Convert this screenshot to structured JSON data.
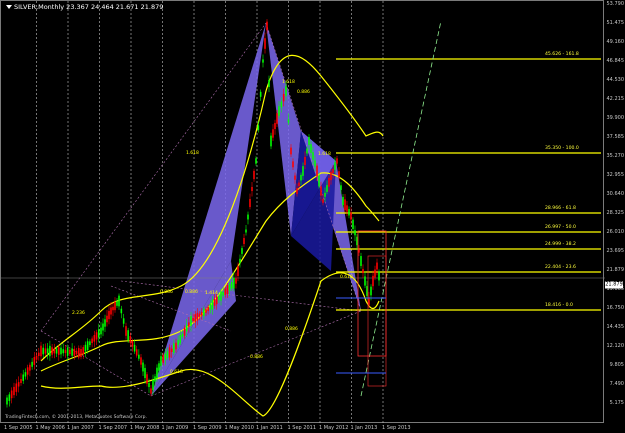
{
  "window": {
    "symbol_line": "SILVER,Monthly  23.367 24.464 21.671 21.879",
    "copyright": "TradingFintech.com, © 2001-2013, MetaQuotes Software Corp."
  },
  "price_axis": {
    "labels": [
      "53.790",
      "51.475",
      "49.160",
      "46.845",
      "44.530",
      "42.215",
      "39.900",
      "37.585",
      "35.270",
      "32.955",
      "30.640",
      "28.325",
      "26.010",
      "23.695",
      "21.879",
      "19.065",
      "16.750",
      "14.435",
      "12.120",
      "9.805",
      "7.490",
      "5.175"
    ],
    "current_price": "21.879"
  },
  "time_axis": {
    "labels": [
      "1 Sep 2005",
      "1 May 2006",
      "1 Jan 2007",
      "1 Sep 2007",
      "1 May 2008",
      "1 Jan 2009",
      "1 Sep 2009",
      "1 May 2010",
      "1 Jan 2011",
      "1 Sep 2011",
      "1 May 2012",
      "1 Jan 2013",
      "1 Sep 2013"
    ]
  },
  "levels": [
    {
      "label": "45.626 - 161.8"
    },
    {
      "label": "35.350 - 100.0"
    },
    {
      "label": "28.966 - 61.8"
    },
    {
      "label": "26.997 - 50.0"
    },
    {
      "label": "24.999 - 38.2"
    },
    {
      "label": "22.404 - 23.6"
    },
    {
      "label": "18.416 - 0.0"
    }
  ],
  "annotations": [
    "2.236",
    "0.886",
    "0.886",
    "1.618",
    "1.414",
    "1.618",
    "0.886",
    "0.886",
    "0.886",
    "1.618",
    "0.618",
    "0.618"
  ],
  "colors": {
    "background": "#000000",
    "candle_up": "#00ff00",
    "candle_down": "#ff0000",
    "bands": "#ffff00",
    "harmonic_fill": "#7b68ee",
    "harmonic_dark": "#1a1aa0",
    "trendline": "#90ee90",
    "level": "#ffff00"
  }
}
